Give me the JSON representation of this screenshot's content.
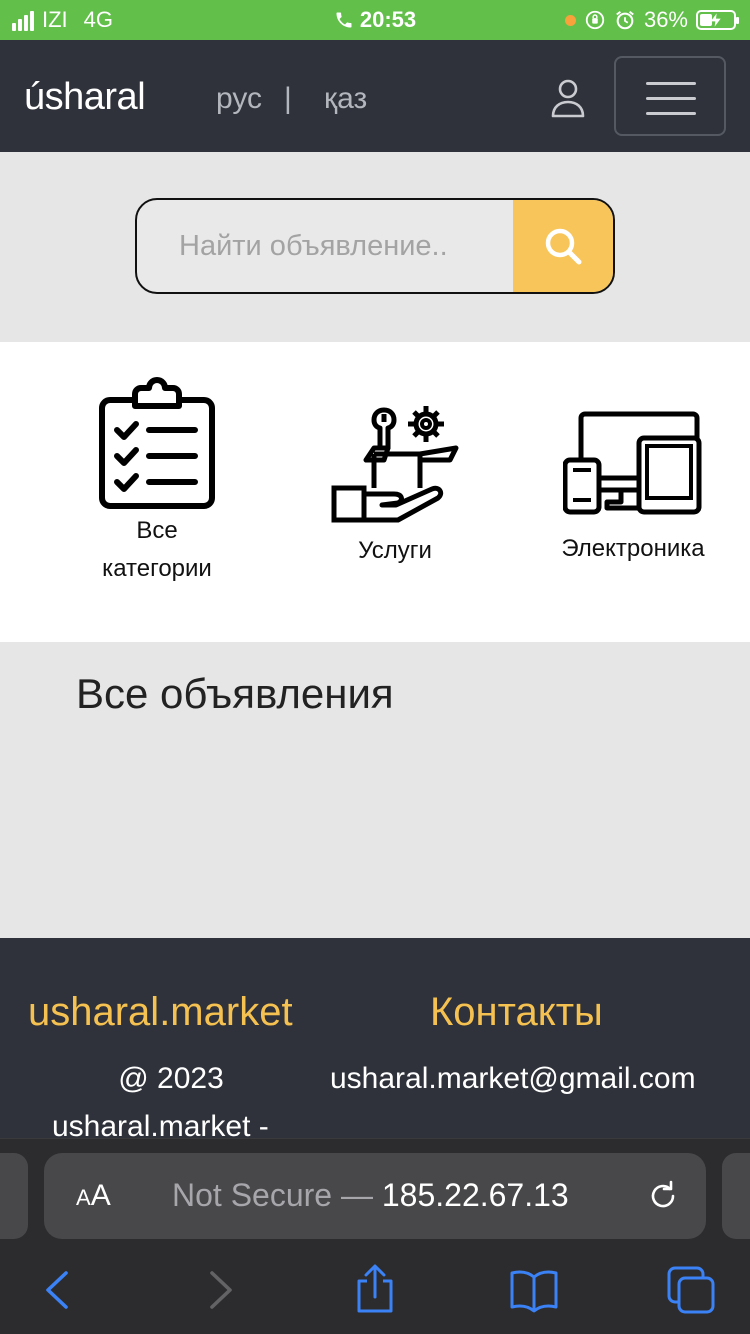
{
  "status_bar": {
    "carrier": "IZI",
    "network": "4G",
    "time": "20:53",
    "battery": "36%"
  },
  "header": {
    "logo": "úsharal",
    "lang_ru": "рус",
    "lang_sep": "|",
    "lang_kz": "қаз",
    "icons": [
      "user-icon",
      "hamburger-menu-icon"
    ]
  },
  "search": {
    "placeholder": "Найти объявление..",
    "button_icon": "search-icon",
    "button_color": "#f7c55a"
  },
  "categories": [
    {
      "label_line1": "Все",
      "label_line2": "категории",
      "icon": "clipboard-checklist-icon"
    },
    {
      "label": "Услуги",
      "icon": "services-tools-icon"
    },
    {
      "label": "Электроника",
      "icon": "devices-icon"
    }
  ],
  "main": {
    "section_title": "Все объявления"
  },
  "footer": {
    "brand": "usharal.market",
    "contacts_title": "Контакты",
    "copyright": "@ 2023",
    "copyright_line2": "usharal.market -",
    "email": "usharal.market@gmail.com",
    "accent_color": "#f5c150"
  },
  "browser": {
    "text_size_small": "A",
    "text_size_large": "A",
    "url_prefix": "Not Secure — ",
    "url_host": "185.22.67.13",
    "icons": [
      "back-icon",
      "forward-icon",
      "share-icon",
      "bookmarks-icon",
      "tabs-icon",
      "reload-icon"
    ],
    "accent_color": "#3b82f6"
  }
}
